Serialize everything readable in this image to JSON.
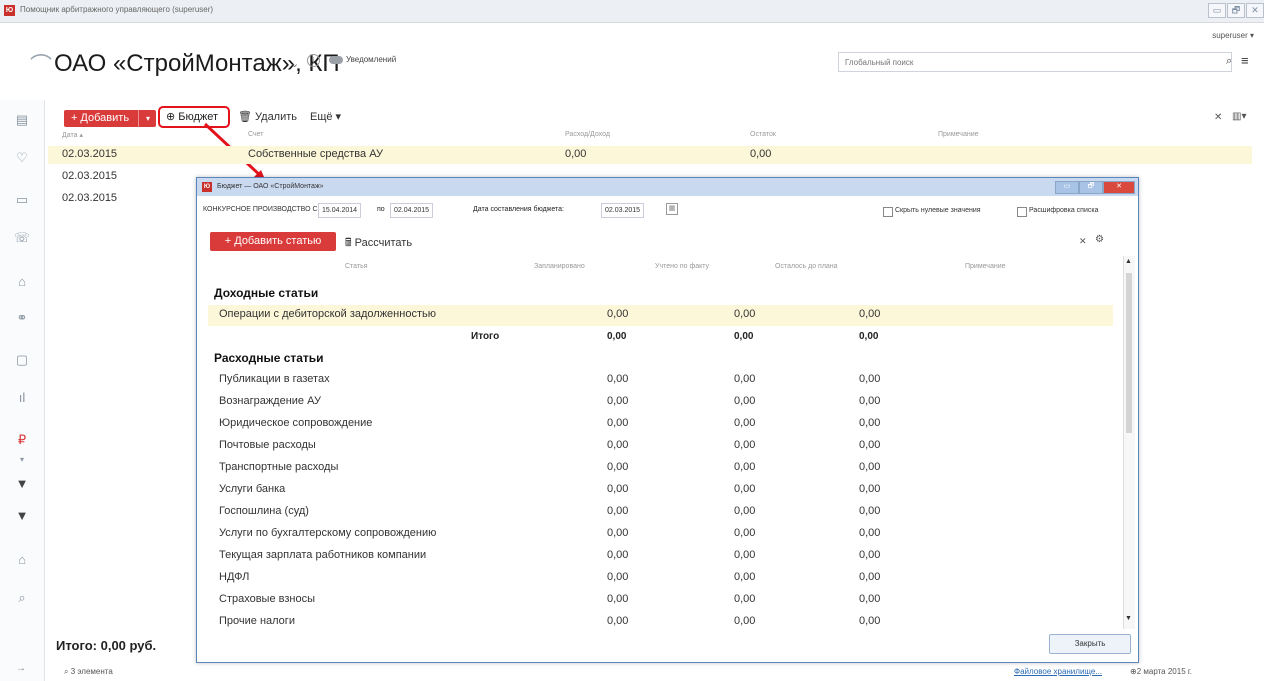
{
  "window": {
    "title": "Помощник арбитражного управляющего (superuser)",
    "app_icon": "Ю",
    "min": "▭",
    "max": "🗗",
    "close": "✕",
    "user": "superuser ▾"
  },
  "header": {
    "company_title": "ОАО «СтройМонтаж», КП",
    "chevron": "⌄",
    "info": "i",
    "notifications_label": "Уведомлений",
    "search_placeholder": "Глобальный поиск",
    "search_icon": "⌕",
    "menu_icon": "≡",
    "company_icon": "⌒"
  },
  "toolbar": {
    "add_label": "+ Добавить",
    "add_arrow": "▾",
    "budget_label": "⊕ Бюджет",
    "delete_label": "🗑 Удалить",
    "more_label": "Ещё ▾",
    "close_x": "✕",
    "columns_icon": "▥▾"
  },
  "table": {
    "headers": {
      "date": "Дата ▴",
      "account": "Счет",
      "amount": "Расход/Доход",
      "balance": "Остаток",
      "note": "Примечание"
    },
    "rows": [
      {
        "date": "02.03.2015",
        "account": "Собственные средства АУ",
        "amount": "0,00",
        "balance": "0,00"
      },
      {
        "date": "02.03.2015"
      },
      {
        "date": "02.03.2015"
      }
    ]
  },
  "footer": {
    "total": "Итого:  0,00 руб.",
    "count": "⌕ 3 элемента",
    "storage_link": "Файловое хранилище...",
    "date": "⊕2 марта 2015 г."
  },
  "dialog": {
    "title": "Бюджет — ОАО «СтройМонтаж»",
    "params_label": "КОНКУРСНОЕ ПРОИЗВОДСТВО С",
    "from_date": "15.04.2014",
    "to_label": "по",
    "to_date": "02.04.2015",
    "compile_label": "Дата составления бюджета:",
    "compile_date": "02.03.2015",
    "hide_zero": "Скрыть нулевые значения",
    "expand_list": "Расшифровка списка",
    "add_article": "+ Добавить статью",
    "calculate": "🖩 Рассчитать",
    "close_button": "Закрыть",
    "headers": {
      "article": "Статья",
      "planned": "Запланировано",
      "actual": "Учтено по факту",
      "remaining": "Осталось до плана",
      "note": "Примечание"
    },
    "income_section": "Доходные статьи",
    "income_rows": [
      {
        "name": "Операции с дебиторской задолженностью",
        "planned": "0,00",
        "actual": "0,00",
        "remaining": "0,00"
      }
    ],
    "income_total": {
      "label": "Итого",
      "planned": "0,00",
      "actual": "0,00",
      "remaining": "0,00"
    },
    "expense_section": "Расходные статьи",
    "expense_rows": [
      {
        "name": "Публикации в газетах",
        "planned": "0,00",
        "actual": "0,00",
        "remaining": "0,00"
      },
      {
        "name": "Вознаграждение АУ",
        "planned": "0,00",
        "actual": "0,00",
        "remaining": "0,00"
      },
      {
        "name": "Юридическое сопровождение",
        "planned": "0,00",
        "actual": "0,00",
        "remaining": "0,00"
      },
      {
        "name": "Почтовые расходы",
        "planned": "0,00",
        "actual": "0,00",
        "remaining": "0,00"
      },
      {
        "name": "Транспортные расходы",
        "planned": "0,00",
        "actual": "0,00",
        "remaining": "0,00"
      },
      {
        "name": "Услуги банка",
        "planned": "0,00",
        "actual": "0,00",
        "remaining": "0,00"
      },
      {
        "name": "Госпошлина (суд)",
        "planned": "0,00",
        "actual": "0,00",
        "remaining": "0,00"
      },
      {
        "name": "Услуги по бухгалтерскому сопровождению",
        "planned": "0,00",
        "actual": "0,00",
        "remaining": "0,00"
      },
      {
        "name": "Текущая зарплата работников компании",
        "planned": "0,00",
        "actual": "0,00",
        "remaining": "0,00"
      },
      {
        "name": "НДФЛ",
        "planned": "0,00",
        "actual": "0,00",
        "remaining": "0,00"
      },
      {
        "name": "Страховые взносы",
        "planned": "0,00",
        "actual": "0,00",
        "remaining": "0,00"
      },
      {
        "name": "Прочие налоги",
        "planned": "0,00",
        "actual": "0,00",
        "remaining": "0,00"
      }
    ]
  },
  "sidebar_icons": [
    "▤",
    "♡",
    "▭",
    "☏",
    "⌂",
    "⚭",
    "▢",
    "ıl",
    "₽",
    "▾",
    "▼",
    "▼",
    "⌂",
    "⌕"
  ],
  "colors": {
    "accent_red": "#d93a3a",
    "highlight_row": "#fdf7d9",
    "dialog_border": "#5b86bd"
  }
}
